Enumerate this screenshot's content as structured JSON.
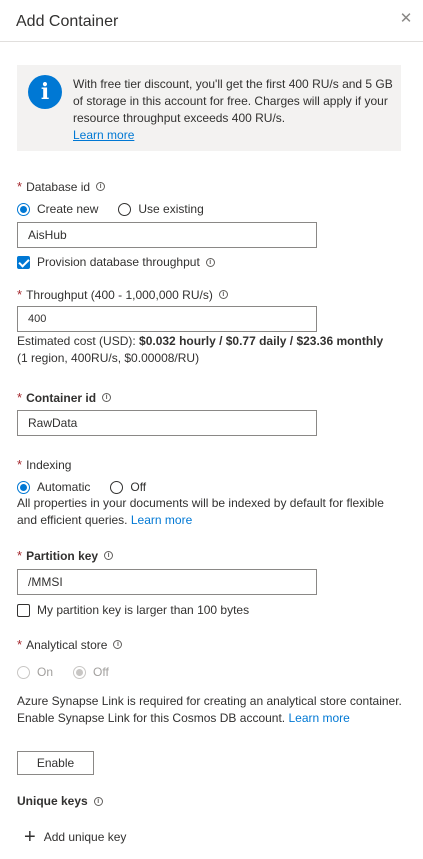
{
  "header": {
    "title": "Add Container",
    "close_glyph": "✕"
  },
  "info_banner": {
    "icon_glyph": "i",
    "text": "With free tier discount, you'll get the first 400 RU/s and 5 GB of storage in this account for free. Charges will apply if your resource throughput exceeds 400 RU/s.",
    "link": "Learn more"
  },
  "database": {
    "label": "Database id",
    "required_mark": "*",
    "options": [
      "Create new",
      "Use existing"
    ],
    "selected": "Create new",
    "value": "AisHub",
    "provision_label": "Provision database throughput",
    "provision_checked": true
  },
  "throughput": {
    "label": "Throughput (400 - 1,000,000 RU/s)",
    "value": "400",
    "cost_prefix": "Estimated cost (USD): ",
    "cost_bold": "$0.032 hourly / $0.77 daily / $23.36 monthly",
    "cost_detail": "(1 region, 400RU/s, $0.00008/RU)"
  },
  "container": {
    "label": "Container id",
    "value": "RawData"
  },
  "indexing": {
    "label": "Indexing",
    "options": [
      "Automatic",
      "Off"
    ],
    "selected": "Automatic",
    "description": "All properties in your documents will be indexed by default for flexible and efficient queries.",
    "link": "Learn more"
  },
  "partition": {
    "label": "Partition key",
    "value": "/MMSI",
    "large_key_label": "My partition key is larger than 100 bytes",
    "large_key_checked": false
  },
  "analytical": {
    "label": "Analytical store",
    "options": [
      "On",
      "Off"
    ],
    "selected": "Off",
    "disabled": true,
    "description": "Azure Synapse Link is required for creating an analytical store container. Enable Synapse Link for this Cosmos DB account.",
    "link": "Learn more",
    "enable_button": "Enable"
  },
  "unique_keys": {
    "label": "Unique keys",
    "add_label": "Add unique key",
    "add_glyph": "+"
  },
  "info_glyph": "i",
  "colors": {
    "accent": "#0078d4",
    "required": "#a4262c",
    "banner_bg": "#f3f2f1"
  }
}
